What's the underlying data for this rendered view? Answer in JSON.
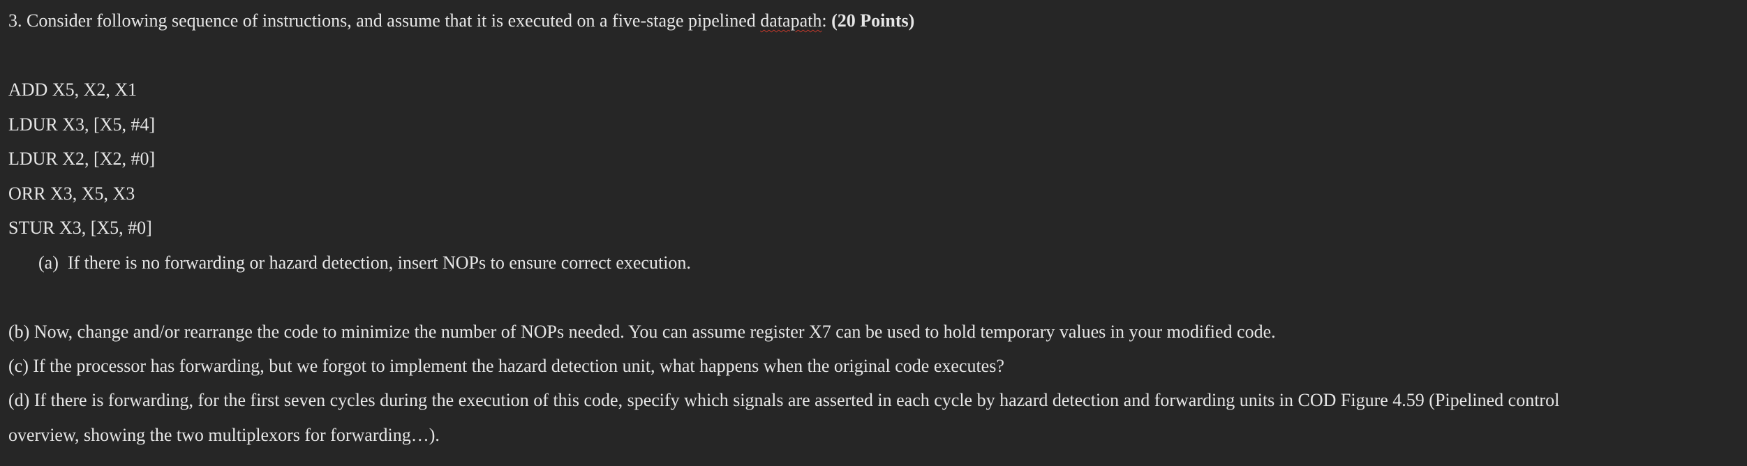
{
  "question": {
    "heading_prefix": "3. Consider following sequence of instructions, and assume that it is executed on a five-stage pipelined ",
    "heading_misspelled": "datapath",
    "heading_colon": ": ",
    "heading_points": "(20 Points)"
  },
  "instructions": [
    "ADD X5, X2, X1",
    "LDUR X3, [X5, #4]",
    "LDUR X2, [X2, #0]",
    "ORR X3, X5, X3",
    "STUR X3, [X5, #0]"
  ],
  "parts": {
    "a": "(a)  If there is no forwarding or hazard detection, insert NOPs to ensure correct execution.",
    "b": "(b) Now, change and/or rearrange the code to minimize the number of NOPs needed. You can assume register X7 can be used to hold temporary values in your modified code.",
    "c": "(c) If the processor has forwarding, but we forgot to implement the hazard detection unit, what happens when the original code executes?",
    "d_line1": "(d) If there is forwarding, for the first seven cycles during the execution of this code, specify which signals are asserted in each cycle by hazard detection and forwarding units in COD Figure 4.59 (Pipelined control",
    "d_line2": "overview, showing the two multiplexors for forwarding…)."
  }
}
